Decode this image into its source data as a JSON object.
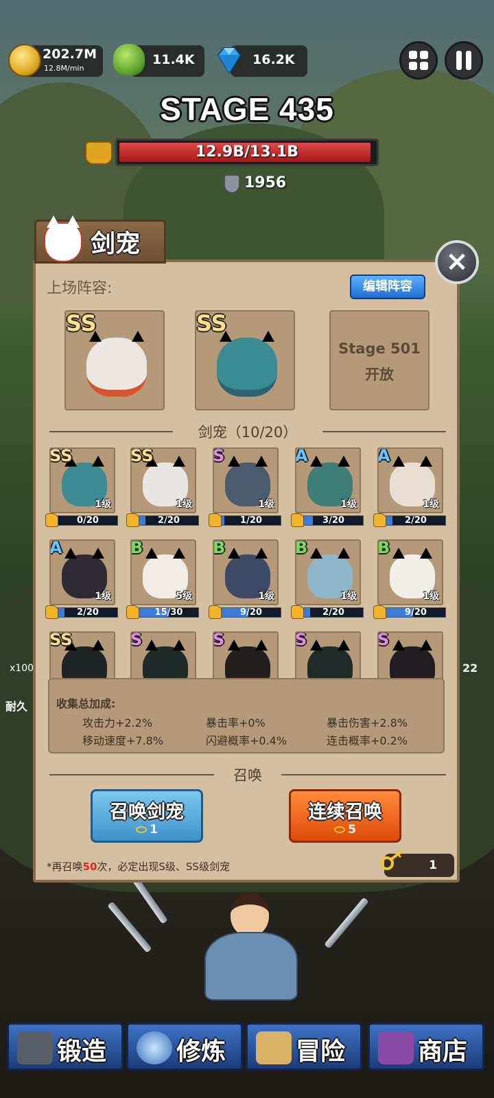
{
  "resources": {
    "gold": "202.7M",
    "gold_rate": "12.8M/min",
    "slime": "11.4K",
    "gems": "16.2K"
  },
  "stage": {
    "title": "STAGE 435",
    "hp_text": "12.9B/13.1B",
    "hp_fraction": 0.985,
    "defense": "1956"
  },
  "panel": {
    "title": "剑宠",
    "lineup_label": "上场阵容:",
    "edit_button": "编辑阵容",
    "lineup": [
      {
        "grade": "SS"
      },
      {
        "grade": "SS"
      },
      {
        "locked_line1": "Stage 501",
        "locked_line2": "开放"
      }
    ],
    "collection_header": "剑宠（10/20）",
    "pets": [
      {
        "grade": "SS",
        "level": "1级",
        "progress": "0/20",
        "fill": 0.0,
        "color": "#3e8b93"
      },
      {
        "grade": "SS",
        "level": "1级",
        "progress": "2/20",
        "fill": 0.1,
        "color": "#e9e5e2"
      },
      {
        "grade": "S",
        "level": "1级",
        "progress": "1/20",
        "fill": 0.05,
        "color": "#4c5a6e"
      },
      {
        "grade": "A",
        "level": "1级",
        "progress": "3/20",
        "fill": 0.15,
        "color": "#3e7d78"
      },
      {
        "grade": "A",
        "level": "1级",
        "progress": "2/20",
        "fill": 0.1,
        "color": "#e8ddd0"
      },
      {
        "grade": "A",
        "level": "1级",
        "progress": "2/20",
        "fill": 0.1,
        "color": "#2f2a33"
      },
      {
        "grade": "B",
        "level": "5级",
        "progress": "15/30",
        "fill": 0.5,
        "color": "#f1ece6"
      },
      {
        "grade": "B",
        "level": "1级",
        "progress": "9/20",
        "fill": 0.45,
        "color": "#3d4a66"
      },
      {
        "grade": "B",
        "level": "1级",
        "progress": "2/20",
        "fill": 0.1,
        "color": "#8fb6c9"
      },
      {
        "grade": "B",
        "level": "1级",
        "progress": "9/20",
        "fill": 0.45,
        "color": "#f2eee8"
      },
      {
        "grade": "SS",
        "silhouette": true,
        "color": "#1f2426"
      },
      {
        "grade": "S",
        "silhouette": true,
        "color": "#1d2a28"
      },
      {
        "grade": "S",
        "silhouette": true,
        "color": "#231f1f"
      },
      {
        "grade": "S",
        "silhouette": true,
        "color": "#202a2a"
      },
      {
        "grade": "S",
        "silhouette": true,
        "color": "#221d22"
      }
    ],
    "bonus_title": "收集总加成:",
    "bonuses": [
      "攻击力+2.2%",
      "暴击率+0%",
      "暴击伤害+2.8%",
      "移动速度+7.8%",
      "闪避概率+0.4%",
      "连击概率+0.2%"
    ],
    "summon_header": "召唤",
    "summon_single": {
      "label": "召唤剑宠",
      "cost": "1"
    },
    "summon_multi": {
      "label": "连续召唤",
      "cost": "5"
    },
    "hint_prefix": "*再召唤",
    "hint_count": "50",
    "hint_suffix": "次，必定出现S级、SS级剑宠",
    "keys_owned": "1"
  },
  "side": {
    "left_mult": "x100",
    "left_label": "耐久",
    "right_count": "22"
  },
  "nav": [
    {
      "label": "锻造",
      "icon": "anvil-icon"
    },
    {
      "label": "修炼",
      "icon": "orb-icon"
    },
    {
      "label": "冒险",
      "icon": "map-icon"
    },
    {
      "label": "商店",
      "icon": "chest-icon"
    }
  ],
  "colors": {
    "panel_bg": "#d4bfa0",
    "grade_ss": "#ffe08a",
    "grade_s": "#e58ae8",
    "grade_a": "#66c4ff",
    "grade_b": "#79de5d",
    "summon_blue": "#3d90c9",
    "summon_orange": "#de4a0a"
  }
}
